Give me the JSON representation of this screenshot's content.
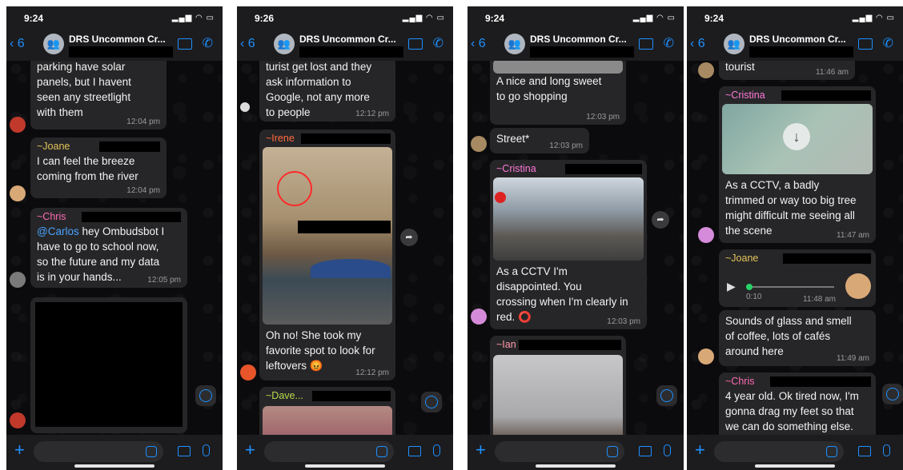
{
  "screens": [
    {
      "time": "9:24",
      "back_count": "6",
      "group_name": "DRS Uncommon Cr...",
      "messages": {
        "m1_text": "parking have solar\npanels, but I havent\nseen any streetlight\nwith them",
        "m1_time": "12:04 pm",
        "m2_sender": "~Joane",
        "m2_text": "I can feel the breeze\ncoming from the river",
        "m2_time": "12:04 pm",
        "m3_sender": "~Chris",
        "m3_mention": "@Carlos",
        "m3_text_a": " hey Ombudsbot I",
        "m3_text_b": "have to go to school now,\nso the future and my data\nis in your hands...",
        "m3_time": "12:05 pm"
      }
    },
    {
      "time": "9:26",
      "back_count": "6",
      "group_name": "DRS Uncommon Cr...",
      "messages": {
        "m1_text": "turist get lost and they\nask information to\nGoogle, not any more\nto people",
        "m1_time": "12:12 pm",
        "m2_sender": "~Irene",
        "m2_text": "Oh no! She took my\nfavorite spot to look for\nleftovers 😡",
        "m2_time": "12:12 pm",
        "m3_sender": "~Dave..."
      }
    },
    {
      "time": "9:24",
      "back_count": "6",
      "group_name": "DRS Uncommon Cr...",
      "messages": {
        "m1_text": "A nice and long sweet\nto go shopping",
        "m1_time": "12:03 pm",
        "m2_text": "Street*",
        "m2_time": "12:03 pm",
        "m3_sender": "~Cristina",
        "m3_text": "As a CCTV I'm\ndisappointed.  You\ncrossing when I'm clearly in\nred. ⭕",
        "m3_time": "12:03 pm",
        "m4_sender": "~Ian"
      }
    },
    {
      "time": "9:24",
      "back_count": "6",
      "group_name": "DRS Uncommon Cr...",
      "messages": {
        "m1_text": "tourist",
        "m1_time": "11:46 am",
        "m2_sender": "~Cristina",
        "m2_text": "As a CCTV, a badly\ntrimmed or way too big tree\nmight difficult me seeing all\nthe scene",
        "m2_time": "11:47 am",
        "m3_sender": "~Joane",
        "m3_duration": "0:10",
        "m3_time": "11:48 am",
        "m4_text": "Sounds of glass and smell\nof coffee, lots of cafés\naround here",
        "m4_time": "11:49 am",
        "m5_sender": "~Chris",
        "m5_text": "4 year old. Ok tired now, I'm\ngonna drag my feet so that\nwe can do something else."
      }
    }
  ],
  "colors": {
    "accent": "#1e90ff",
    "joane": "#e3c35a",
    "chris": "#ff6bb3",
    "irene": "#ff6a3d",
    "dave": "#b8d94a",
    "cristina": "#ff7ad9",
    "ian": "#ff9aa8"
  }
}
